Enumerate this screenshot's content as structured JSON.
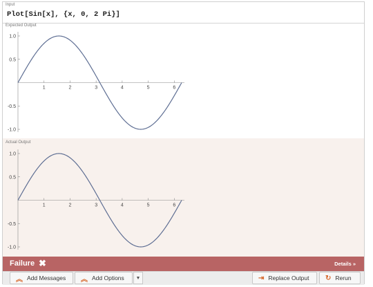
{
  "input": {
    "label": "Input",
    "code": "Plot[Sin[x], {x, 0, 2 Pi}]"
  },
  "expected": {
    "label": "Expected Output"
  },
  "actual": {
    "label": "Actual Output"
  },
  "status": {
    "failure_label": "Failure",
    "failure_icon": "x-icon",
    "details_label": "Details »"
  },
  "buttons": {
    "add_messages": "Add Messages",
    "add_options": "Add Options",
    "replace_output": "Replace Output",
    "rerun": "Rerun"
  },
  "colors": {
    "failure_bar": "#b86464",
    "actual_bg": "#f8f1ed",
    "curve": "#5e6e93",
    "button_icon": "#d76a2f"
  },
  "chart_data": [
    {
      "type": "line",
      "function": "sin(x)",
      "x": [
        0,
        0.5,
        1,
        1.5707963,
        2,
        2.5,
        3,
        3.1415927,
        3.5,
        4,
        4.5,
        4.712389,
        5,
        5.5,
        6,
        6.2831853
      ],
      "y": [
        0,
        0.4794,
        0.8415,
        1,
        0.9093,
        0.5985,
        0.1411,
        0,
        -0.3508,
        -0.7568,
        -0.9775,
        -1,
        -0.9589,
        -0.7055,
        -0.2794,
        0
      ],
      "xlim": [
        0,
        6.2831853
      ],
      "ylim": [
        -1,
        1
      ],
      "x_ticks": [
        "1",
        "2",
        "3",
        "4",
        "5",
        "6"
      ],
      "y_ticks": [
        "1.0",
        "0.5",
        "-0.5",
        "-1.0"
      ],
      "grid": false
    },
    {
      "type": "line",
      "function": "sin(x)",
      "x": [
        0,
        0.5,
        1,
        1.5707963,
        2,
        2.5,
        3,
        3.1415927,
        3.5,
        4,
        4.5,
        4.712389,
        5,
        5.5,
        6,
        6.2831853
      ],
      "y": [
        0,
        0.4794,
        0.8415,
        1,
        0.9093,
        0.5985,
        0.1411,
        0,
        -0.3508,
        -0.7568,
        -0.9775,
        -1,
        -0.9589,
        -0.7055,
        -0.2794,
        0
      ],
      "xlim": [
        0,
        6.2831853
      ],
      "ylim": [
        -1,
        1
      ],
      "x_ticks": [
        "1",
        "2",
        "3",
        "4",
        "5",
        "6"
      ],
      "y_ticks": [
        "1.0",
        "0.5",
        "-0.5",
        "-1.0"
      ],
      "grid": false
    }
  ]
}
